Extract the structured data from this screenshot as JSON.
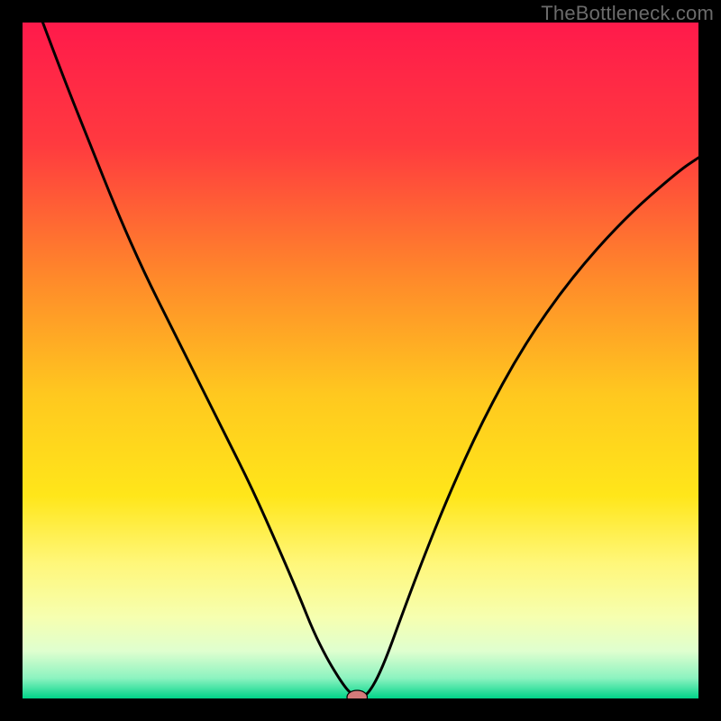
{
  "watermark": "TheBottleneck.com",
  "chart_data": {
    "type": "line",
    "title": "",
    "xlabel": "",
    "ylabel": "",
    "xlim": [
      0,
      100
    ],
    "ylim": [
      0,
      100
    ],
    "grid": false,
    "legend": false,
    "background": {
      "type": "vertical-gradient",
      "stops": [
        {
          "offset": 0.0,
          "color": "#ff1a4b"
        },
        {
          "offset": 0.18,
          "color": "#ff3a3f"
        },
        {
          "offset": 0.38,
          "color": "#ff8a2a"
        },
        {
          "offset": 0.55,
          "color": "#ffc81f"
        },
        {
          "offset": 0.7,
          "color": "#ffe61a"
        },
        {
          "offset": 0.8,
          "color": "#fff77a"
        },
        {
          "offset": 0.88,
          "color": "#f6ffb0"
        },
        {
          "offset": 0.93,
          "color": "#dfffcf"
        },
        {
          "offset": 0.97,
          "color": "#8cf3c0"
        },
        {
          "offset": 1.0,
          "color": "#00d489"
        }
      ]
    },
    "series": [
      {
        "name": "bottleneck-curve",
        "color": "#000000",
        "x": [
          3,
          6,
          10,
          14,
          18,
          22,
          26,
          30,
          34,
          38,
          41,
          43,
          45,
          46.5,
          47.5,
          48.3,
          49,
          49.5,
          50,
          50.5,
          51.3,
          52.5,
          54,
          56,
          59,
          63,
          68,
          74,
          81,
          89,
          97,
          100
        ],
        "values": [
          100,
          92,
          82,
          72,
          63,
          55,
          47,
          39,
          31,
          22,
          15,
          10,
          6,
          3.5,
          2,
          1,
          0.5,
          0.3,
          0.2,
          0.3,
          1,
          3,
          6.5,
          12,
          20,
          30,
          41,
          52,
          62,
          71,
          78,
          80
        ]
      }
    ],
    "marker": {
      "name": "optimal-point",
      "x": 49.5,
      "y": 0.2,
      "rx": 1.5,
      "ry": 1.0,
      "fill": "#d47a7a",
      "stroke": "#000000"
    }
  }
}
